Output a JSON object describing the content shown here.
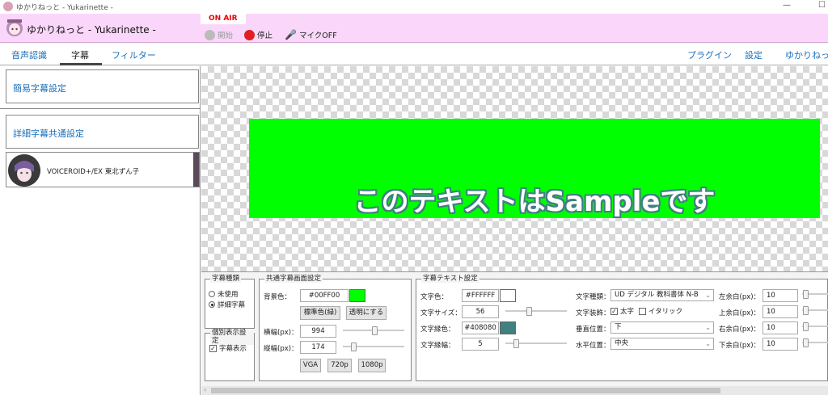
{
  "window": {
    "title": "ゆかりねっと - Yukarinette -",
    "minimize": "—",
    "maximize": "☐"
  },
  "header": {
    "app_title": "ゆかりねっと - Yukarinette -",
    "on_air": "ON AIR",
    "start_label": "開始",
    "stop_label": "停止",
    "mic_label": "マイクOFF"
  },
  "tabs": {
    "items": [
      "音声認識",
      "字幕",
      "フィルター"
    ],
    "active": "字幕"
  },
  "right_tabs": [
    "プラグイン",
    "設定",
    "ゆかりねっと"
  ],
  "left": {
    "simple": "簡易字幕設定",
    "detail": "詳細字幕共通設定",
    "voice": "VOICEROID+/EX 東北ずん子"
  },
  "preview": {
    "sample_text": "このテキストはSampleです"
  },
  "subtitle_type": {
    "title": "字幕種類",
    "options": [
      "未使用",
      "詳細字幕"
    ],
    "selected": "詳細字幕"
  },
  "individual": {
    "title": "個別表示設定",
    "show_subtitle": "字幕表示",
    "checked": true
  },
  "common_screen": {
    "title": "共通字幕画面設定",
    "bg_label": "背景色：",
    "bg_value": "#00FF00",
    "bg_color": "#00ff00",
    "standard_btn": "標準色(緑)",
    "transparent_btn": "透明にする",
    "width_label": "横幅(px)：",
    "width_value": "994",
    "height_label": "縦幅(px)：",
    "height_value": "174",
    "preset_vga": "VGA",
    "preset_720": "720p",
    "preset_1080": "1080p"
  },
  "text_settings": {
    "title": "字幕テキスト設定",
    "color_label": "文字色：",
    "color_value": "#FFFFFF",
    "color_hex": "#ffffff",
    "size_label": "文字サイズ：",
    "size_value": "56",
    "outline_label": "文字縁色：",
    "outline_value": "#408080",
    "outline_hex": "#408080",
    "outline_width_label": "文字縁幅：",
    "outline_width_value": "5",
    "font_label": "文字種類：",
    "font_value": "UD デジタル 教科書体 N-B",
    "decoration_label": "文字装飾：",
    "bold_label": "太字",
    "bold_checked": true,
    "italic_label": "イタリック",
    "italic_checked": false,
    "vpos_label": "垂直位置：",
    "vpos_value": "下",
    "hpos_label": "水平位置：",
    "hpos_value": "中央",
    "margin_left_label": "左余白(px)：",
    "margin_left_value": "10",
    "margin_top_label": "上余白(px)：",
    "margin_top_value": "10",
    "margin_right_label": "右余白(px)：",
    "margin_right_value": "10",
    "margin_bottom_label": "下余白(px)：",
    "margin_bottom_value": "10"
  }
}
